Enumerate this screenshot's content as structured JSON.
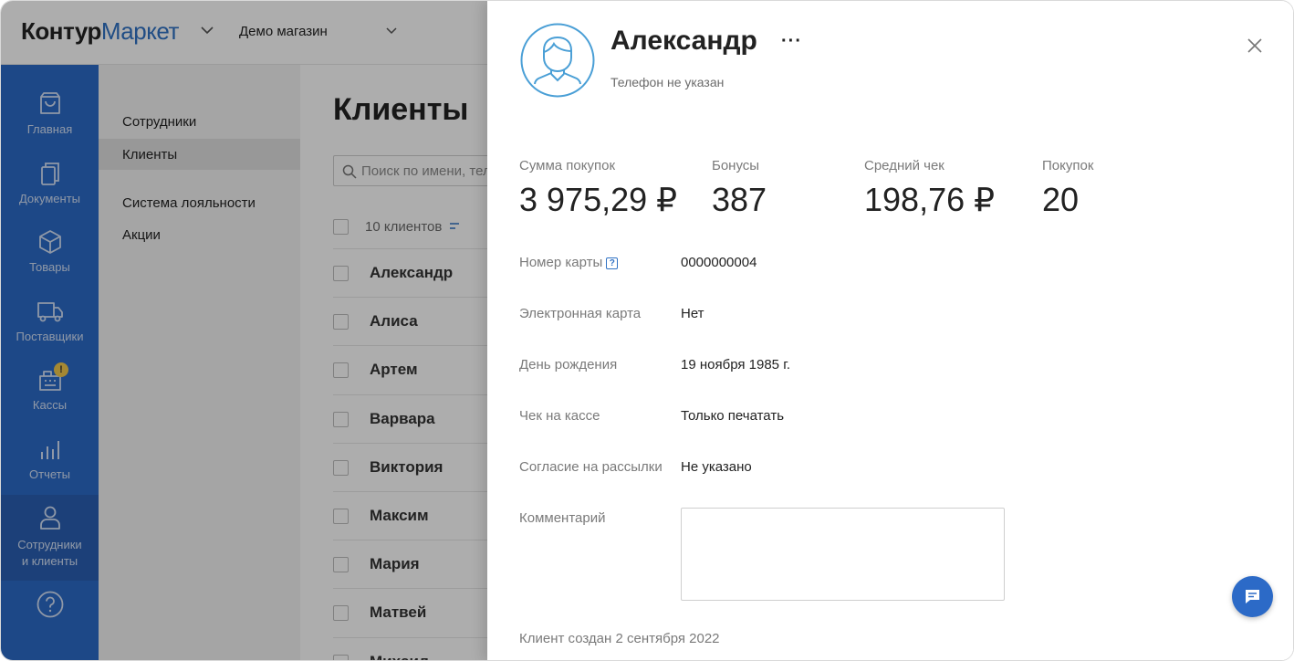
{
  "header": {
    "logo_part1": "Контур",
    "logo_part2": "Маркет",
    "shop_name": "Демо магазин"
  },
  "nav": {
    "items": [
      {
        "label": "Главная",
        "icon": "shopping-bag-icon"
      },
      {
        "label": "Документы",
        "icon": "documents-icon"
      },
      {
        "label": "Товары",
        "icon": "box-icon"
      },
      {
        "label": "Поставщики",
        "icon": "truck-icon"
      },
      {
        "label": "Кассы",
        "icon": "cash-register-icon",
        "badge": "!"
      },
      {
        "label": "Отчеты",
        "icon": "bar-chart-icon"
      },
      {
        "label1": "Сотрудники",
        "label2": "и клиенты",
        "icon": "person-icon",
        "active": true
      },
      {
        "icon": "help-icon"
      }
    ]
  },
  "submenu": {
    "items": [
      "Сотрудники",
      "Клиенты",
      "Система лояльности",
      "Акции"
    ],
    "active": "Клиенты"
  },
  "main": {
    "title": "Клиенты",
    "search_placeholder": "Поиск по имени, телефону",
    "count_label": "10 клиентов",
    "clients": [
      "Александр",
      "Алиса",
      "Артем",
      "Варвара",
      "Виктория",
      "Максим",
      "Мария",
      "Матвей",
      "Михаил"
    ]
  },
  "drawer": {
    "name": "Александр",
    "more": "···",
    "phone": "Телефон не указан",
    "stats": [
      {
        "label": "Сумма покупок",
        "value": "3 975,29 ₽"
      },
      {
        "label": "Бонусы",
        "value": "387"
      },
      {
        "label": "Средний чек",
        "value": "198,76 ₽"
      },
      {
        "label": "Покупок",
        "value": "20"
      }
    ],
    "fields": [
      {
        "label": "Номер карты",
        "value": "0000000004",
        "help": "?"
      },
      {
        "label": "Электронная карта",
        "value": "Нет"
      },
      {
        "label": "День рождения",
        "value": "19 ноября 1985 г."
      },
      {
        "label": "Чек на кассе",
        "value": "Только печатать"
      },
      {
        "label": "Согласие на рассылки",
        "value": "Не указано"
      }
    ],
    "comment_label": "Комментарий",
    "comment_value": "",
    "created": "Клиент создан 2 сентября 2022"
  },
  "colors": {
    "brand_blue": "#2c6ac7",
    "logo_blue": "#3072c4",
    "avatar_blue": "#4a9fd6"
  }
}
